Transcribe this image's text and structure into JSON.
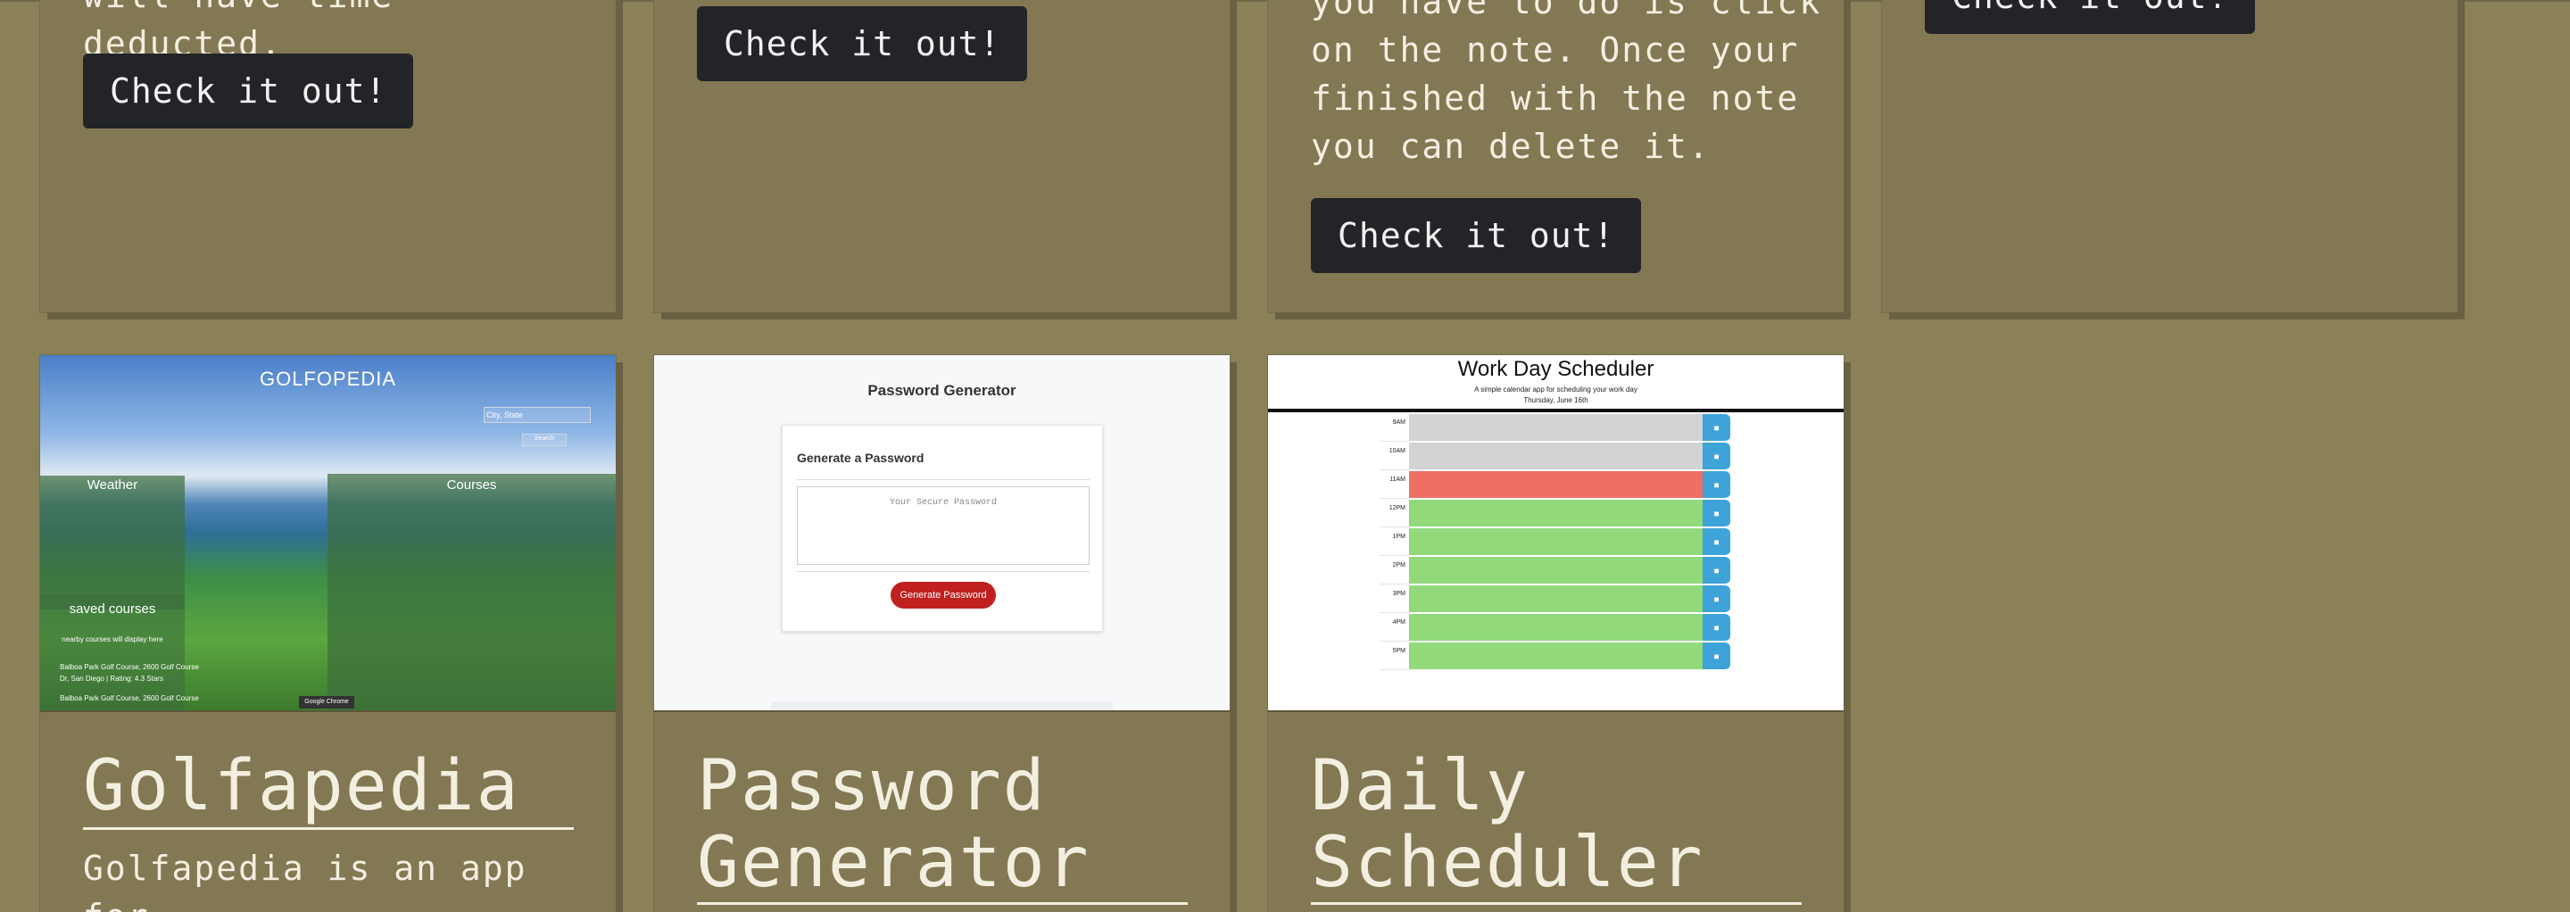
{
  "top_row": [
    {
      "text": "will have time deducted.",
      "button": "Check it out!"
    },
    {
      "text": "",
      "button": "Check it out!"
    },
    {
      "text": "you have to do is click\non the note. Once your\nfinished with the note\nyou can delete it.",
      "button": "Check it out!"
    },
    {
      "text": "",
      "button": "Check it out!"
    }
  ],
  "projects": [
    {
      "title": "Golfapedia",
      "description": "Golfapedia is an app for",
      "thumbnail": {
        "heading": "GOLFOPEDIA",
        "search_placeholder": "City, State",
        "search_button": "Search",
        "weather_label": "Weather",
        "courses_label": "Courses",
        "saved_label": "saved courses",
        "saved_note": "nearby courses will display here",
        "course_line_1": "Balboa Park Golf Course, 2600 Golf Course",
        "course_line_2": "Dr, San Diego | Rating: 4.3 Stars",
        "course_line_3": "Balboa Park Golf Course, 2600 Golf Course",
        "tooltip": "Google Chrome"
      }
    },
    {
      "title": "Password Generator",
      "description": "",
      "thumbnail": {
        "heading": "Password Generator",
        "card_title": "Generate a Password",
        "textarea_placeholder": "Your Secure Password",
        "button": "Generate Password"
      }
    },
    {
      "title": "Daily Scheduler",
      "description": "",
      "thumbnail": {
        "heading": "Work Day Scheduler",
        "subtitle": "A simple calendar app for scheduling your work day",
        "date": "Thursday, June 16th",
        "hours": [
          "9AM",
          "10AM",
          "11AM",
          "12PM",
          "1PM",
          "2PM",
          "3PM",
          "4PM",
          "5PM"
        ],
        "hour_states": [
          "past",
          "past",
          "present",
          "future",
          "future",
          "future",
          "future",
          "future",
          "future"
        ]
      }
    }
  ],
  "colors": {
    "background": "#8a8159",
    "card": "#837854",
    "button": "#222428",
    "past": "#d3d3d3",
    "present": "#ee6f63",
    "future": "#92d97c",
    "save": "#3ea3d8"
  }
}
